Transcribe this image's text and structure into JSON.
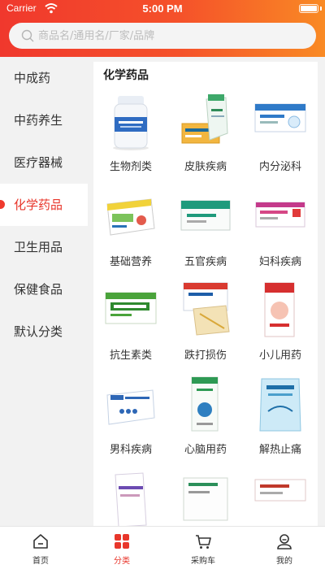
{
  "status_bar": {
    "carrier": "Carrier",
    "time": "5:00 PM"
  },
  "search": {
    "placeholder": "商品名/通用名/厂家/品牌"
  },
  "sidebar": {
    "items": [
      {
        "label": "中成药"
      },
      {
        "label": "中药养生"
      },
      {
        "label": "医疗器械"
      },
      {
        "label": "化学药品",
        "active": true
      },
      {
        "label": "卫生用品"
      },
      {
        "label": "保健食品"
      },
      {
        "label": "默认分类"
      }
    ]
  },
  "content": {
    "title": "化学药品",
    "categories": [
      {
        "label": "生物剂类"
      },
      {
        "label": "皮肤疾病"
      },
      {
        "label": "内分泌科"
      },
      {
        "label": "基础营养"
      },
      {
        "label": "五官疾病"
      },
      {
        "label": "妇科疾病"
      },
      {
        "label": "抗生素类"
      },
      {
        "label": "跌打损伤"
      },
      {
        "label": "小儿用药"
      },
      {
        "label": "男科疾病"
      },
      {
        "label": "心脑用药"
      },
      {
        "label": "解热止痛"
      },
      {
        "label": ""
      },
      {
        "label": ""
      },
      {
        "label": ""
      }
    ]
  },
  "tabbar": {
    "tabs": [
      {
        "label": "首页",
        "icon": "home-icon"
      },
      {
        "label": "分类",
        "icon": "category-icon",
        "active": true
      },
      {
        "label": "采购车",
        "icon": "cart-icon"
      },
      {
        "label": "我的",
        "icon": "profile-icon"
      }
    ]
  },
  "colors": {
    "accent": "#e8362b",
    "header_start": "#f0382d",
    "header_end": "#f98a24"
  }
}
